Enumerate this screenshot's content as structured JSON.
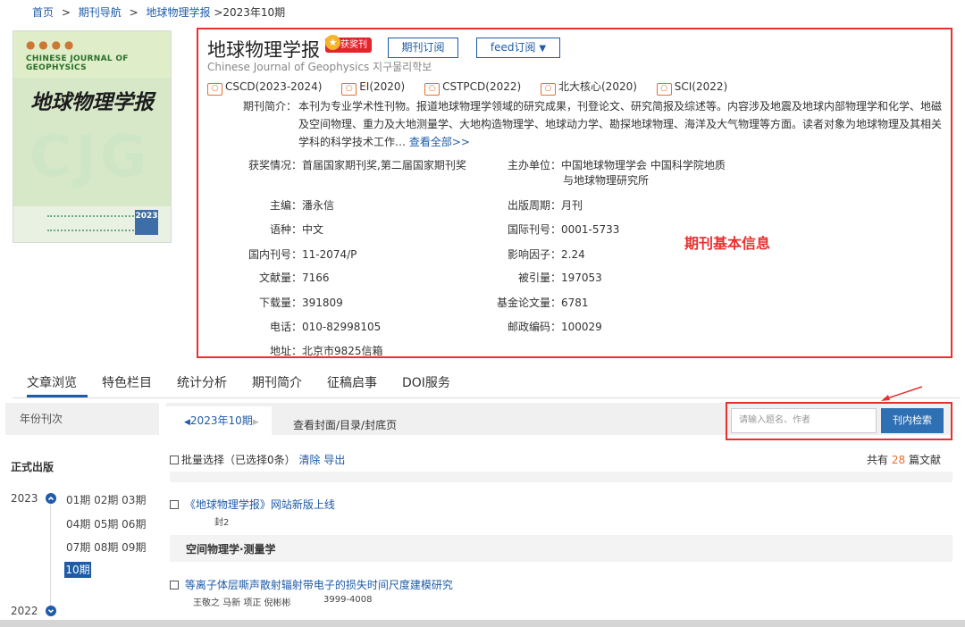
{
  "breadcrumb": {
    "home": "首页",
    "sep": ">",
    "nav": "期刊导航",
    "journal": "地球物理学报",
    "current": ">2023年10期"
  },
  "cover": {
    "en_title": "CHINESE JOURNAL OF GEOPHYSICS",
    "cn_title": "地球物理学报",
    "big_text": "CJG",
    "year": "2023"
  },
  "journal": {
    "title": "地球物理学报",
    "award_badge": "获奖刊",
    "subscribe_button": "期刊订阅",
    "feed_button": "feed订阅",
    "english_name": "Chinese Journal of Geophysics 지구물리학보",
    "indexes": [
      {
        "name": "CSCD(2023-2024)"
      },
      {
        "name": "EI(2020)"
      },
      {
        "name": "CSTPCD(2022)"
      },
      {
        "name": "北大核心(2020)"
      },
      {
        "name": "SCI(2022)"
      }
    ],
    "index_icon_char": "⎔",
    "intro_label": "期刊简介：",
    "intro_text": "本刊为专业学术性刊物。报道地球物理学领域的研究成果，刊登论文、研究简报及综述等。内容涉及地震及地球内部物理学和化学、地磁及空间物理、重力及大地测量学、大地构造物理学、地球动力学、勘探地球物理、海洋及大气物理等方面。读者对象为地球物理及其相关学科的科学技术工作…",
    "intro_more": "查看全部>>",
    "fields_left": [
      {
        "label": "获奖情况：",
        "value": "首届国家期刊奖,第二届国家期刊奖"
      },
      {
        "label": "主编：",
        "value": "潘永信"
      },
      {
        "label": "语种：",
        "value": "中文"
      },
      {
        "label": "国内刊号：",
        "value": "11-2074/P"
      },
      {
        "label": "文献量：",
        "value": "7166"
      },
      {
        "label": "下载量：",
        "value": "391809"
      },
      {
        "label": "电话：",
        "value": "010-82998105"
      },
      {
        "label": "地址：",
        "value": "北京市9825信箱"
      }
    ],
    "sponsor_label": "主办单位：",
    "sponsor_line1": "中国地球物理学会 中国科学院地质",
    "sponsor_line2": "与地球物理研究所",
    "fields_right": [
      {
        "label": "出版周期：",
        "value": "月刊"
      },
      {
        "label": "国际刊号：",
        "value": "0001-5733"
      },
      {
        "label": "影响因子：",
        "value": "2.24"
      },
      {
        "label": "被引量：",
        "value": "197053"
      },
      {
        "label": "基金论文量：",
        "value": "6781"
      },
      {
        "label": "邮政编码：",
        "value": "100029"
      }
    ],
    "annotation": "期刊基本信息"
  },
  "tabs": [
    {
      "label": "文章浏览",
      "active": true
    },
    {
      "label": "特色栏目"
    },
    {
      "label": "统计分析"
    },
    {
      "label": "期刊简介"
    },
    {
      "label": "征稿启事"
    },
    {
      "label": "DOI服务"
    }
  ],
  "sidebar": {
    "header": "年份刊次",
    "section_title": "正式出版",
    "year_2023": "2023",
    "months_row1": "01期 02期 03期",
    "months_row2": "04期 05期 06期",
    "months_row3": "07期 08期 09期",
    "current_month": "10期",
    "year_2022": "2022"
  },
  "main": {
    "issue_tab": "2023年10期",
    "cover_link": "查看封面/目录/封底页",
    "search_placeholder": "请输入题名、作者",
    "search_button": "刊内检索",
    "batch_label": "批量选择（已选择0条）",
    "clear": "清除",
    "export": "导出",
    "total_prefix": "共有",
    "total_count": "28",
    "total_suffix": "篇文献",
    "articles": [
      {
        "title": "《地球物理学报》网站新版上线",
        "meta": "封2"
      },
      {
        "title": "等离子体层嘶声散射辐射带电子的损失时间尺度建模研究",
        "authors": "王敬之 马新 项正 倪彬彬",
        "pages": "3999-4008"
      }
    ],
    "section_title": "空间物理学·测量学"
  },
  "colors": {
    "accent": "#1e5ba8",
    "highlight_box": "#e8302f",
    "count": "#e8702a"
  }
}
